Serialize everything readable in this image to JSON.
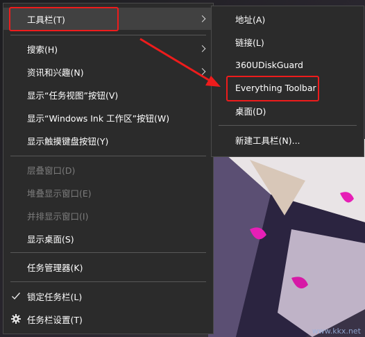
{
  "context_menu": {
    "items": [
      {
        "label": "工具栏(T)",
        "submenu": true
      },
      {
        "label": "搜索(H)",
        "submenu": true
      },
      {
        "label": "资讯和兴趣(N)",
        "submenu": true
      },
      {
        "label": "显示“任务视图”按钮(V)"
      },
      {
        "label": "显示“Windows Ink 工作区”按钮(W)"
      },
      {
        "label": "显示触摸键盘按钮(Y)"
      },
      {
        "label": "层叠窗口(D)",
        "disabled": true
      },
      {
        "label": "堆叠显示窗口(E)",
        "disabled": true
      },
      {
        "label": "并排显示窗口(I)",
        "disabled": true
      },
      {
        "label": "显示桌面(S)"
      },
      {
        "label": "任务管理器(K)"
      },
      {
        "label": "锁定任务栏(L)",
        "checked": true
      },
      {
        "label": "任务栏设置(T)",
        "icon": "gear-icon"
      }
    ]
  },
  "toolbar_submenu": {
    "items": [
      {
        "label": "地址(A)"
      },
      {
        "label": "链接(L)"
      },
      {
        "label": "360UDiskGuard"
      },
      {
        "label": "Everything Toolbar"
      },
      {
        "label": "桌面(D)"
      },
      {
        "label": "新建工具栏(N)..."
      }
    ]
  },
  "annotation": {
    "color": "#ee1c1c"
  },
  "watermark": "www.kkx.net"
}
